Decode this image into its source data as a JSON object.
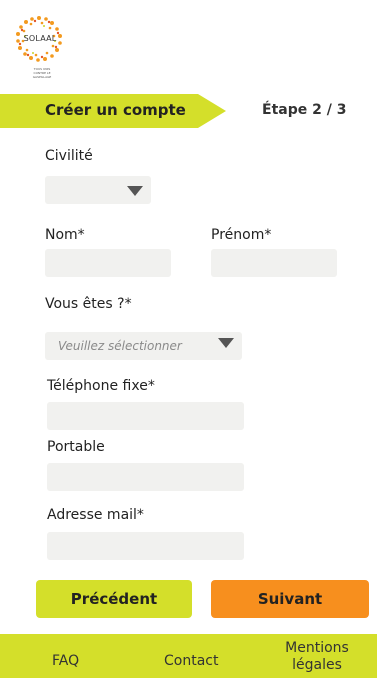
{
  "logo": {
    "name": "SOLAAL",
    "tagline_line1": "TOUS UNIS",
    "tagline_line2": "CONTRE LE GASPILLAGE"
  },
  "step": {
    "title": "Créer un compte",
    "counter": "Étape 2 / 3"
  },
  "form": {
    "civilite_label": "Civilité",
    "civilite_value": "",
    "nom_label": "Nom*",
    "prenom_label": "Prénom*",
    "vous_etes_label": "Vous êtes ?*",
    "vous_etes_placeholder": "Veuillez sélectionner",
    "tel_fixe_label": "Téléphone fixe*",
    "portable_label": "Portable",
    "email_label": "Adresse mail*"
  },
  "buttons": {
    "prev": "Précédent",
    "next": "Suivant"
  },
  "footer": {
    "faq": "FAQ",
    "contact": "Contact",
    "mentions_line1": "Mentions",
    "mentions_line2": "légales"
  },
  "colors": {
    "accent_green": "#d4df2a",
    "accent_orange": "#f78f1e",
    "field_bg": "#f1f1ef"
  }
}
